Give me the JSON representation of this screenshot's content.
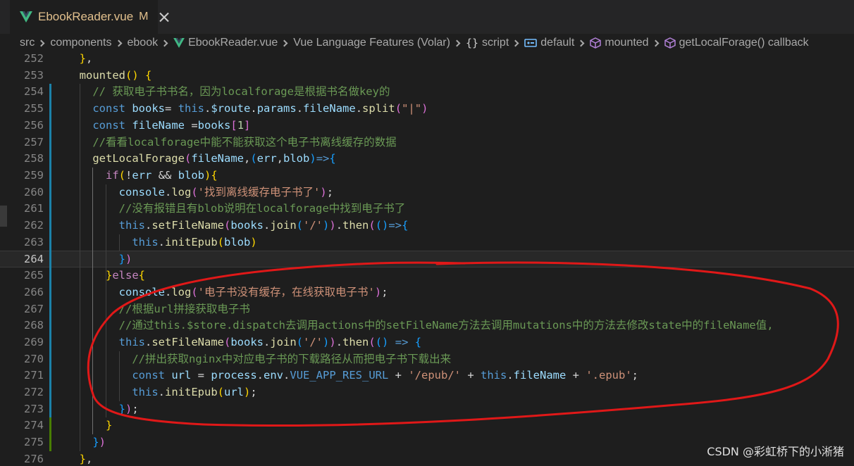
{
  "tab": {
    "title": "EbookReader.vue",
    "modified": "M",
    "icon": "vue-icon"
  },
  "breadcrumb": [
    {
      "label": "src",
      "icon": ""
    },
    {
      "label": "components",
      "icon": ""
    },
    {
      "label": "ebook",
      "icon": ""
    },
    {
      "label": "EbookReader.vue",
      "icon": "vue-icon"
    },
    {
      "label": "Vue Language Features (Volar)",
      "icon": ""
    },
    {
      "label": "script",
      "icon": "braces-icon"
    },
    {
      "label": "default",
      "icon": "module-icon"
    },
    {
      "label": "mounted",
      "icon": "method-cube-icon"
    },
    {
      "label": "getLocalForage() callback",
      "icon": "method-cube-icon"
    }
  ],
  "code_lines": [
    {
      "num": "252",
      "tokens": [
        [
          "p",
          "  "
        ],
        [
          "b1",
          "}"
        ],
        [
          "p",
          ","
        ]
      ]
    },
    {
      "num": "253",
      "tokens": [
        [
          "p",
          "  "
        ],
        [
          "f",
          "mounted"
        ],
        [
          "b1",
          "()"
        ],
        [
          "p",
          " "
        ],
        [
          "b1",
          "{"
        ]
      ]
    },
    {
      "num": "254",
      "tokens": [
        [
          "p",
          "    "
        ],
        [
          "c",
          "// 获取电子书书名，因为localforage是根据书名做key的"
        ]
      ]
    },
    {
      "num": "255",
      "tokens": [
        [
          "p",
          "    "
        ],
        [
          "k",
          "const"
        ],
        [
          "p",
          " "
        ],
        [
          "v",
          "books"
        ],
        [
          "p",
          "= "
        ],
        [
          "k",
          "this"
        ],
        [
          "p",
          "."
        ],
        [
          "v",
          "$route"
        ],
        [
          "p",
          "."
        ],
        [
          "v",
          "params"
        ],
        [
          "p",
          "."
        ],
        [
          "v",
          "fileName"
        ],
        [
          "p",
          "."
        ],
        [
          "f",
          "split"
        ],
        [
          "b2",
          "("
        ],
        [
          "s",
          "\"|\""
        ],
        [
          "b2",
          ")"
        ]
      ]
    },
    {
      "num": "256",
      "tokens": [
        [
          "p",
          "    "
        ],
        [
          "k",
          "const"
        ],
        [
          "p",
          " "
        ],
        [
          "v",
          "fileName"
        ],
        [
          "p",
          " ="
        ],
        [
          "v",
          "books"
        ],
        [
          "b2",
          "["
        ],
        [
          "n",
          "1"
        ],
        [
          "b2",
          "]"
        ]
      ]
    },
    {
      "num": "257",
      "tokens": [
        [
          "p",
          "    "
        ],
        [
          "c",
          "//看看localforage中能不能获取这个电子书离线缓存的数据"
        ]
      ]
    },
    {
      "num": "258",
      "tokens": [
        [
          "p",
          "    "
        ],
        [
          "f",
          "getLocalForage"
        ],
        [
          "b2",
          "("
        ],
        [
          "v",
          "fileName"
        ],
        [
          "p",
          ","
        ],
        [
          "b3",
          "("
        ],
        [
          "v",
          "err"
        ],
        [
          "p",
          ","
        ],
        [
          "v",
          "blob"
        ],
        [
          "b3",
          ")"
        ],
        [
          "k",
          "=>"
        ],
        [
          "b3",
          "{"
        ]
      ]
    },
    {
      "num": "259",
      "tokens": [
        [
          "p",
          "      "
        ],
        [
          "ctl",
          "if"
        ],
        [
          "b1",
          "("
        ],
        [
          "p",
          "!"
        ],
        [
          "v",
          "err"
        ],
        [
          "p",
          " && "
        ],
        [
          "v",
          "blob"
        ],
        [
          "b1",
          ")"
        ],
        [
          "b1",
          "{"
        ]
      ]
    },
    {
      "num": "260",
      "tokens": [
        [
          "p",
          "        "
        ],
        [
          "v",
          "console"
        ],
        [
          "p",
          "."
        ],
        [
          "f",
          "log"
        ],
        [
          "b2",
          "("
        ],
        [
          "s",
          "'找到离线缓存电子书了'"
        ],
        [
          "b2",
          ")"
        ],
        [
          "p",
          ";"
        ]
      ]
    },
    {
      "num": "261",
      "tokens": [
        [
          "p",
          "        "
        ],
        [
          "c",
          "//没有报错且有blob说明在localforage中找到电子书了"
        ]
      ]
    },
    {
      "num": "262",
      "tokens": [
        [
          "p",
          "        "
        ],
        [
          "k",
          "this"
        ],
        [
          "p",
          "."
        ],
        [
          "f",
          "setFileName"
        ],
        [
          "b2",
          "("
        ],
        [
          "v",
          "books"
        ],
        [
          "p",
          "."
        ],
        [
          "f",
          "join"
        ],
        [
          "b3",
          "("
        ],
        [
          "s",
          "'/'"
        ],
        [
          "b3",
          ")"
        ],
        [
          "b2",
          ")"
        ],
        [
          "p",
          "."
        ],
        [
          "f",
          "then"
        ],
        [
          "b2",
          "("
        ],
        [
          "b3",
          "()"
        ],
        [
          "k",
          "=>"
        ],
        [
          "b3",
          "{"
        ]
      ]
    },
    {
      "num": "263",
      "tokens": [
        [
          "p",
          "          "
        ],
        [
          "k",
          "this"
        ],
        [
          "p",
          "."
        ],
        [
          "f",
          "initEpub"
        ],
        [
          "b1",
          "("
        ],
        [
          "v",
          "blob"
        ],
        [
          "b1",
          ")"
        ]
      ]
    },
    {
      "num": "264",
      "tokens": [
        [
          "p",
          "        "
        ],
        [
          "b3",
          "}"
        ],
        [
          "b2",
          ")"
        ]
      ]
    },
    {
      "num": "265",
      "tokens": [
        [
          "p",
          "      "
        ],
        [
          "b1",
          "}"
        ],
        [
          "ctl",
          "else"
        ],
        [
          "b1",
          "{"
        ]
      ]
    },
    {
      "num": "266",
      "tokens": [
        [
          "p",
          "        "
        ],
        [
          "v",
          "console"
        ],
        [
          "p",
          "."
        ],
        [
          "f",
          "log"
        ],
        [
          "b2",
          "("
        ],
        [
          "s",
          "'电子书没有缓存，在线获取电子书'"
        ],
        [
          "b2",
          ")"
        ],
        [
          "p",
          ";"
        ]
      ]
    },
    {
      "num": "267",
      "tokens": [
        [
          "p",
          "        "
        ],
        [
          "c",
          "//根据url拼接获取电子书"
        ]
      ]
    },
    {
      "num": "268",
      "tokens": [
        [
          "p",
          "        "
        ],
        [
          "c",
          "//通过this.$store.dispatch去调用actions中的setFileName方法去调用mutations中的方法去修改state中的fileName值,"
        ]
      ]
    },
    {
      "num": "269",
      "tokens": [
        [
          "p",
          "        "
        ],
        [
          "k",
          "this"
        ],
        [
          "p",
          "."
        ],
        [
          "f",
          "setFileName"
        ],
        [
          "b2",
          "("
        ],
        [
          "v",
          "books"
        ],
        [
          "p",
          "."
        ],
        [
          "f",
          "join"
        ],
        [
          "b3",
          "("
        ],
        [
          "s",
          "'/'"
        ],
        [
          "b3",
          ")"
        ],
        [
          "b2",
          ")"
        ],
        [
          "p",
          "."
        ],
        [
          "f",
          "then"
        ],
        [
          "b2",
          "("
        ],
        [
          "b3",
          "()"
        ],
        [
          "p",
          " "
        ],
        [
          "k",
          "=>"
        ],
        [
          "p",
          " "
        ],
        [
          "b3",
          "{"
        ]
      ]
    },
    {
      "num": "270",
      "tokens": [
        [
          "p",
          "          "
        ],
        [
          "c",
          "//拼出获取nginx中对应电子书的下载路径从而把电子书下载出来"
        ]
      ]
    },
    {
      "num": "271",
      "tokens": [
        [
          "p",
          "          "
        ],
        [
          "k",
          "const"
        ],
        [
          "p",
          " "
        ],
        [
          "v",
          "url"
        ],
        [
          "p",
          " = "
        ],
        [
          "v",
          "process"
        ],
        [
          "p",
          "."
        ],
        [
          "v",
          "env"
        ],
        [
          "p",
          "."
        ],
        [
          "k",
          "VUE_APP_RES_URL"
        ],
        [
          "p",
          " + "
        ],
        [
          "s",
          "'/epub/'"
        ],
        [
          "p",
          " + "
        ],
        [
          "k",
          "this"
        ],
        [
          "p",
          "."
        ],
        [
          "v",
          "fileName"
        ],
        [
          "p",
          " + "
        ],
        [
          "s",
          "'.epub'"
        ],
        [
          "p",
          ";"
        ]
      ]
    },
    {
      "num": "272",
      "tokens": [
        [
          "p",
          "          "
        ],
        [
          "k",
          "this"
        ],
        [
          "p",
          "."
        ],
        [
          "f",
          "initEpub"
        ],
        [
          "b1",
          "("
        ],
        [
          "v",
          "url"
        ],
        [
          "b1",
          ")"
        ],
        [
          "p",
          ";"
        ]
      ]
    },
    {
      "num": "273",
      "tokens": [
        [
          "p",
          "        "
        ],
        [
          "b3",
          "}"
        ],
        [
          "b2",
          ")"
        ],
        [
          "p",
          ";"
        ]
      ]
    },
    {
      "num": "274",
      "tokens": [
        [
          "p",
          "      "
        ],
        [
          "b1",
          "}"
        ]
      ]
    },
    {
      "num": "275",
      "tokens": [
        [
          "p",
          "    "
        ],
        [
          "b3",
          "}"
        ],
        [
          "b2",
          ")"
        ]
      ]
    },
    {
      "num": "276",
      "tokens": [
        [
          "p",
          "  "
        ],
        [
          "b1",
          "}"
        ],
        [
          "p",
          ","
        ]
      ]
    }
  ],
  "active_line": "264",
  "watermark": "CSDN @彩虹桥下的小淅猪",
  "colors": {
    "annotation": "#e01818",
    "modified": "#e2c08d",
    "added_gutter": "#487e02"
  }
}
